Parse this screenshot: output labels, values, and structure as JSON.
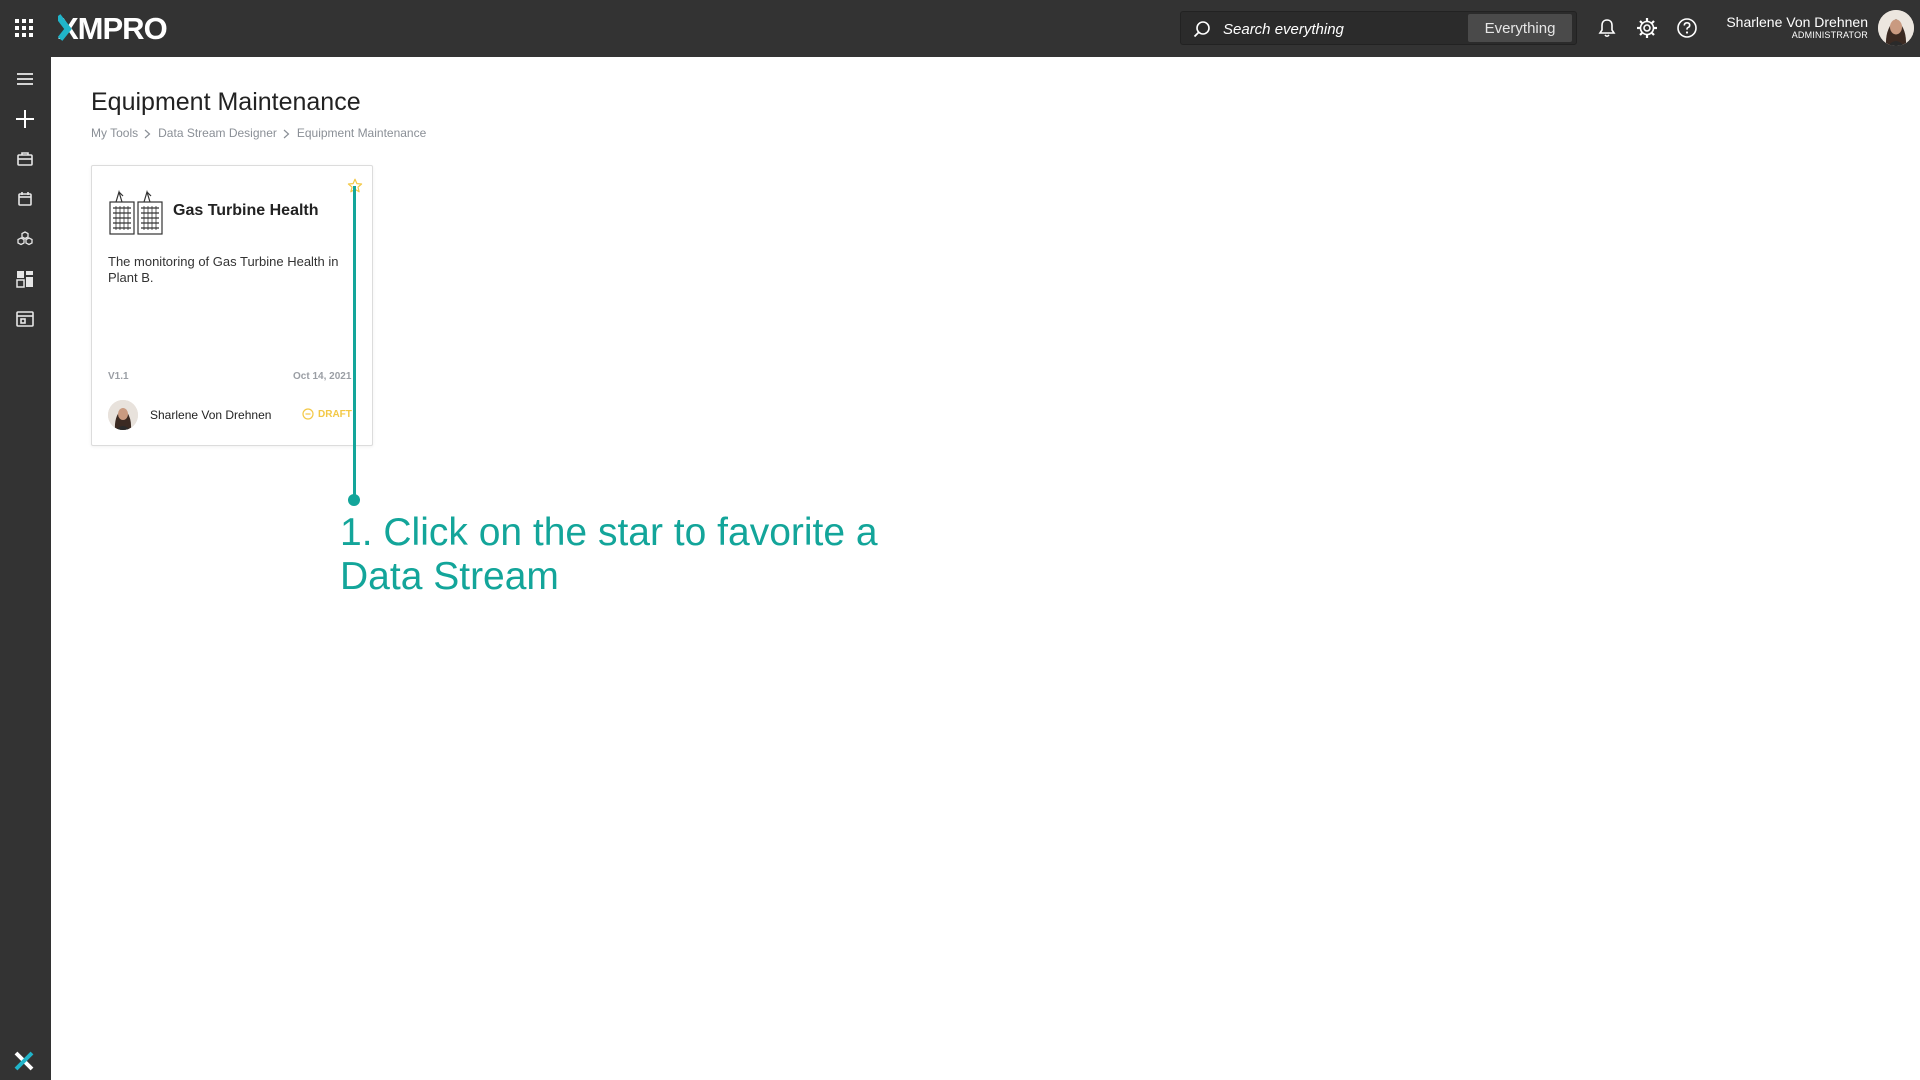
{
  "header": {
    "logo_text": "XMPRO",
    "search": {
      "placeholder": "Search everything",
      "value": "",
      "scope_label": "Everything"
    },
    "user": {
      "name": "Sharlene Von Drehnen",
      "role": "ADMINISTRATOR"
    },
    "icons": [
      "apps-grid-icon",
      "search-icon",
      "bell-icon",
      "gear-icon",
      "help-icon"
    ]
  },
  "sidebar": {
    "items": [
      {
        "icon": "menu-icon"
      },
      {
        "icon": "plus-icon"
      },
      {
        "icon": "briefcase-icon"
      },
      {
        "icon": "calendar-icon"
      },
      {
        "icon": "cubes-icon"
      },
      {
        "icon": "dashboard-icon"
      },
      {
        "icon": "window-icon"
      }
    ],
    "footer_logo_text": "X"
  },
  "main": {
    "title": "Equipment Maintenance",
    "breadcrumb": [
      "My Tools",
      "Data Stream Designer",
      "Equipment Maintenance"
    ],
    "cards": [
      {
        "title": "Gas Turbine Health",
        "description": "The monitoring of Gas Turbine Health in Plant B.",
        "version": "V1.1",
        "date": "Oct 14, 2021",
        "author": "Sharlene Von Drehnen",
        "status": "DRAFT",
        "favorite": false,
        "icon": "turbine-icon"
      }
    ]
  },
  "annotation": {
    "text": "1. Click on the star to favorite a Data Stream"
  },
  "colors": {
    "topbar": "#333333",
    "accent": "#13a59a",
    "logo_accent": "#20b4c9",
    "star": "#f3c846",
    "draft": "#f3c846"
  }
}
